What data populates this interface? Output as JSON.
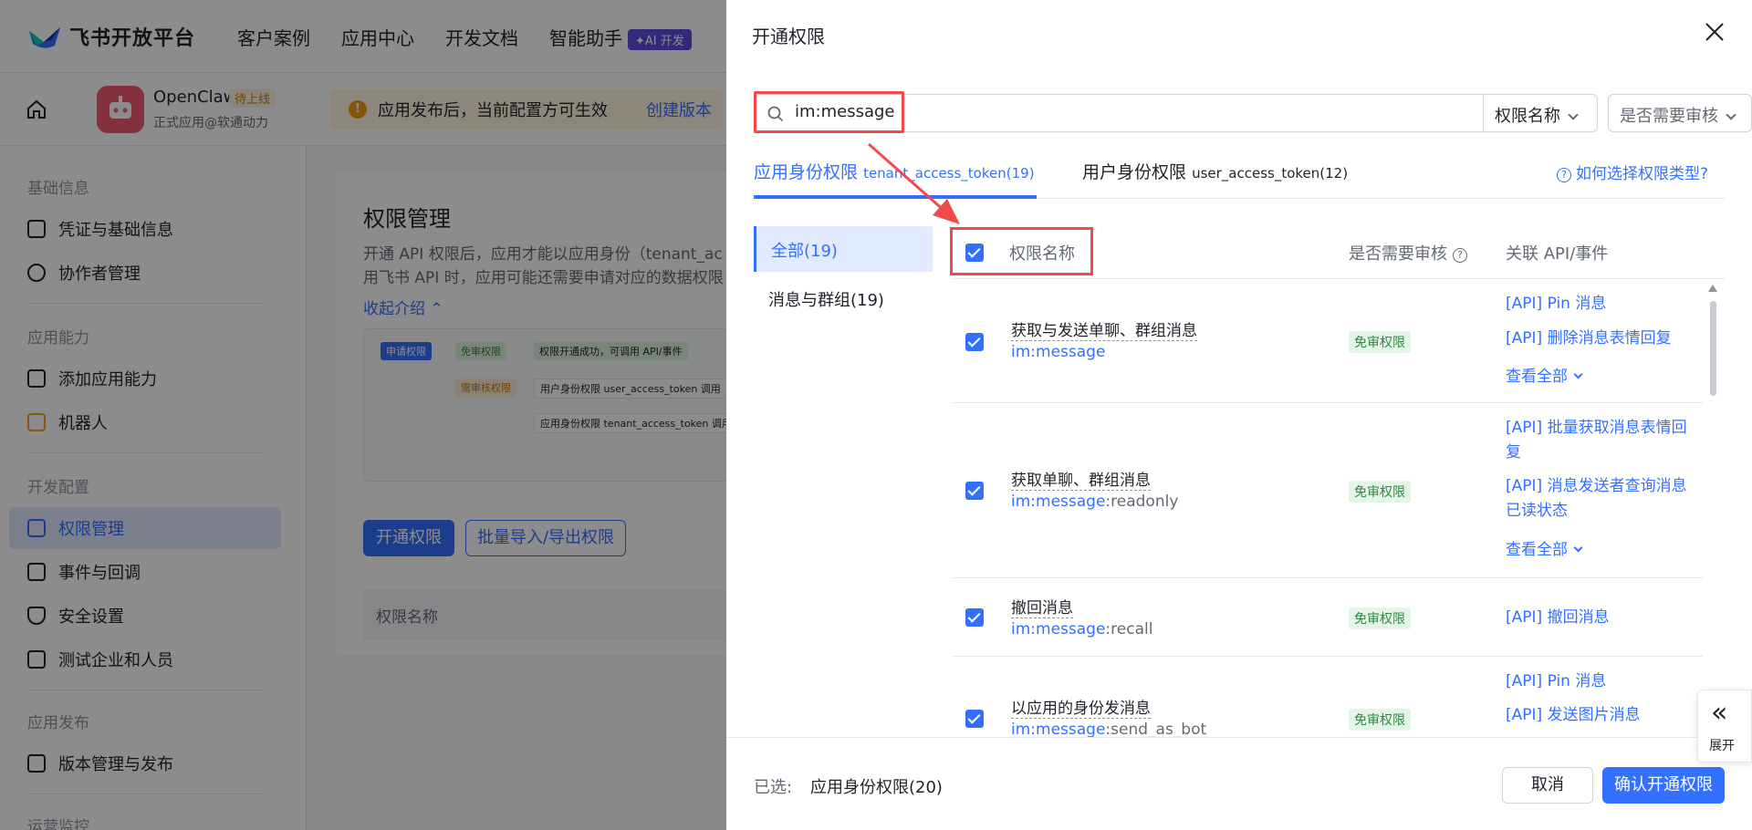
{
  "topnav": {
    "brand": "飞书开放平台",
    "items": [
      "客户案例",
      "应用中心",
      "开发文档",
      "智能助手"
    ],
    "ai_badge": "✦AI 开发"
  },
  "app": {
    "name": "OpenClaw",
    "status": "待上线",
    "subtitle": "正式应用@软通动力",
    "notice": "应用发布后，当前配置方可生效",
    "notice_link": "创建版本"
  },
  "sidebar": {
    "section_basic": "基础信息",
    "item_credentials": "凭证与基础信息",
    "item_collaborators": "协作者管理",
    "section_capability": "应用能力",
    "item_add_capability": "添加应用能力",
    "item_bot": "机器人",
    "section_dev": "开发配置",
    "item_permissions": "权限管理",
    "item_events": "事件与回调",
    "item_security": "安全设置",
    "item_test": "测试企业和人员",
    "section_release": "应用发布",
    "item_version": "版本管理与发布",
    "section_ops": "运营监控"
  },
  "main": {
    "title": "权限管理",
    "desc_line1": "开通 API 权限后，应用才能以应用身份（tenant_ac",
    "desc_line2": "用飞书 API 时，应用可能还需要申请对应的数据权限",
    "collapse": "收起介绍",
    "flow_apply": "申请权限",
    "flow_free": "免审权限",
    "flow_success": "权限开通成功，可调用 API/事件",
    "flow_review": "需审核权限",
    "flow_user": "用户身份权限 user_access_token 调用",
    "flow_tenant": "应用身份权限 tenant_access_token 调用",
    "btn_enable": "开通权限",
    "btn_batch": "批量导入/导出权限",
    "table_header": "权限名称"
  },
  "drawer": {
    "title": "开通权限",
    "search_value": "im:message",
    "select_name": "权限名称",
    "select_review": "是否需要审核",
    "tab_app": "应用身份权限",
    "tab_app_token": "tenant_access_token(19)",
    "tab_user": "用户身份权限",
    "tab_user_token": "user_access_token(12)",
    "help": "如何选择权限类型?",
    "cat_all": "全部(19)",
    "cat_msg": "消息与群组(19)",
    "col_name": "权限名称",
    "col_review": "是否需要审核",
    "col_api": "关联 API/事件",
    "rows": [
      {
        "name": "获取与发送单聊、群组消息",
        "code": "im:message",
        "code_rest": "",
        "tag": "免审权限",
        "apis": [
          "[API] Pin 消息",
          "[API] 删除消息表情回复"
        ],
        "more": "查看全部"
      },
      {
        "name": "获取单聊、群组消息",
        "code": "im:message",
        "code_rest": ":readonly",
        "tag": "免审权限",
        "apis": [
          "[API] 批量获取消息表情回复",
          "[API] 消息发送者查询消息已读状态"
        ],
        "more": "查看全部"
      },
      {
        "name": "撤回消息",
        "code": "im:message",
        "code_rest": ":recall",
        "tag": "免审权限",
        "apis": [
          "[API] 撤回消息"
        ],
        "more": ""
      },
      {
        "name": "以应用的身份发消息",
        "code": "im:message",
        "code_rest": ":send_as_bot",
        "tag": "免审权限",
        "apis": [
          "[API] Pin 消息",
          "[API] 发送图片消息"
        ],
        "more": ""
      }
    ],
    "footer_label": "已选:",
    "footer_value": "应用身份权限(20)",
    "cancel": "取消",
    "confirm": "确认开通权限",
    "expand": "展开"
  },
  "colors": {
    "accent": "#3370ff",
    "annotation": "#f04a4a",
    "tag_bg": "#e4f5e7",
    "tag_fg": "#2d8a3e"
  }
}
